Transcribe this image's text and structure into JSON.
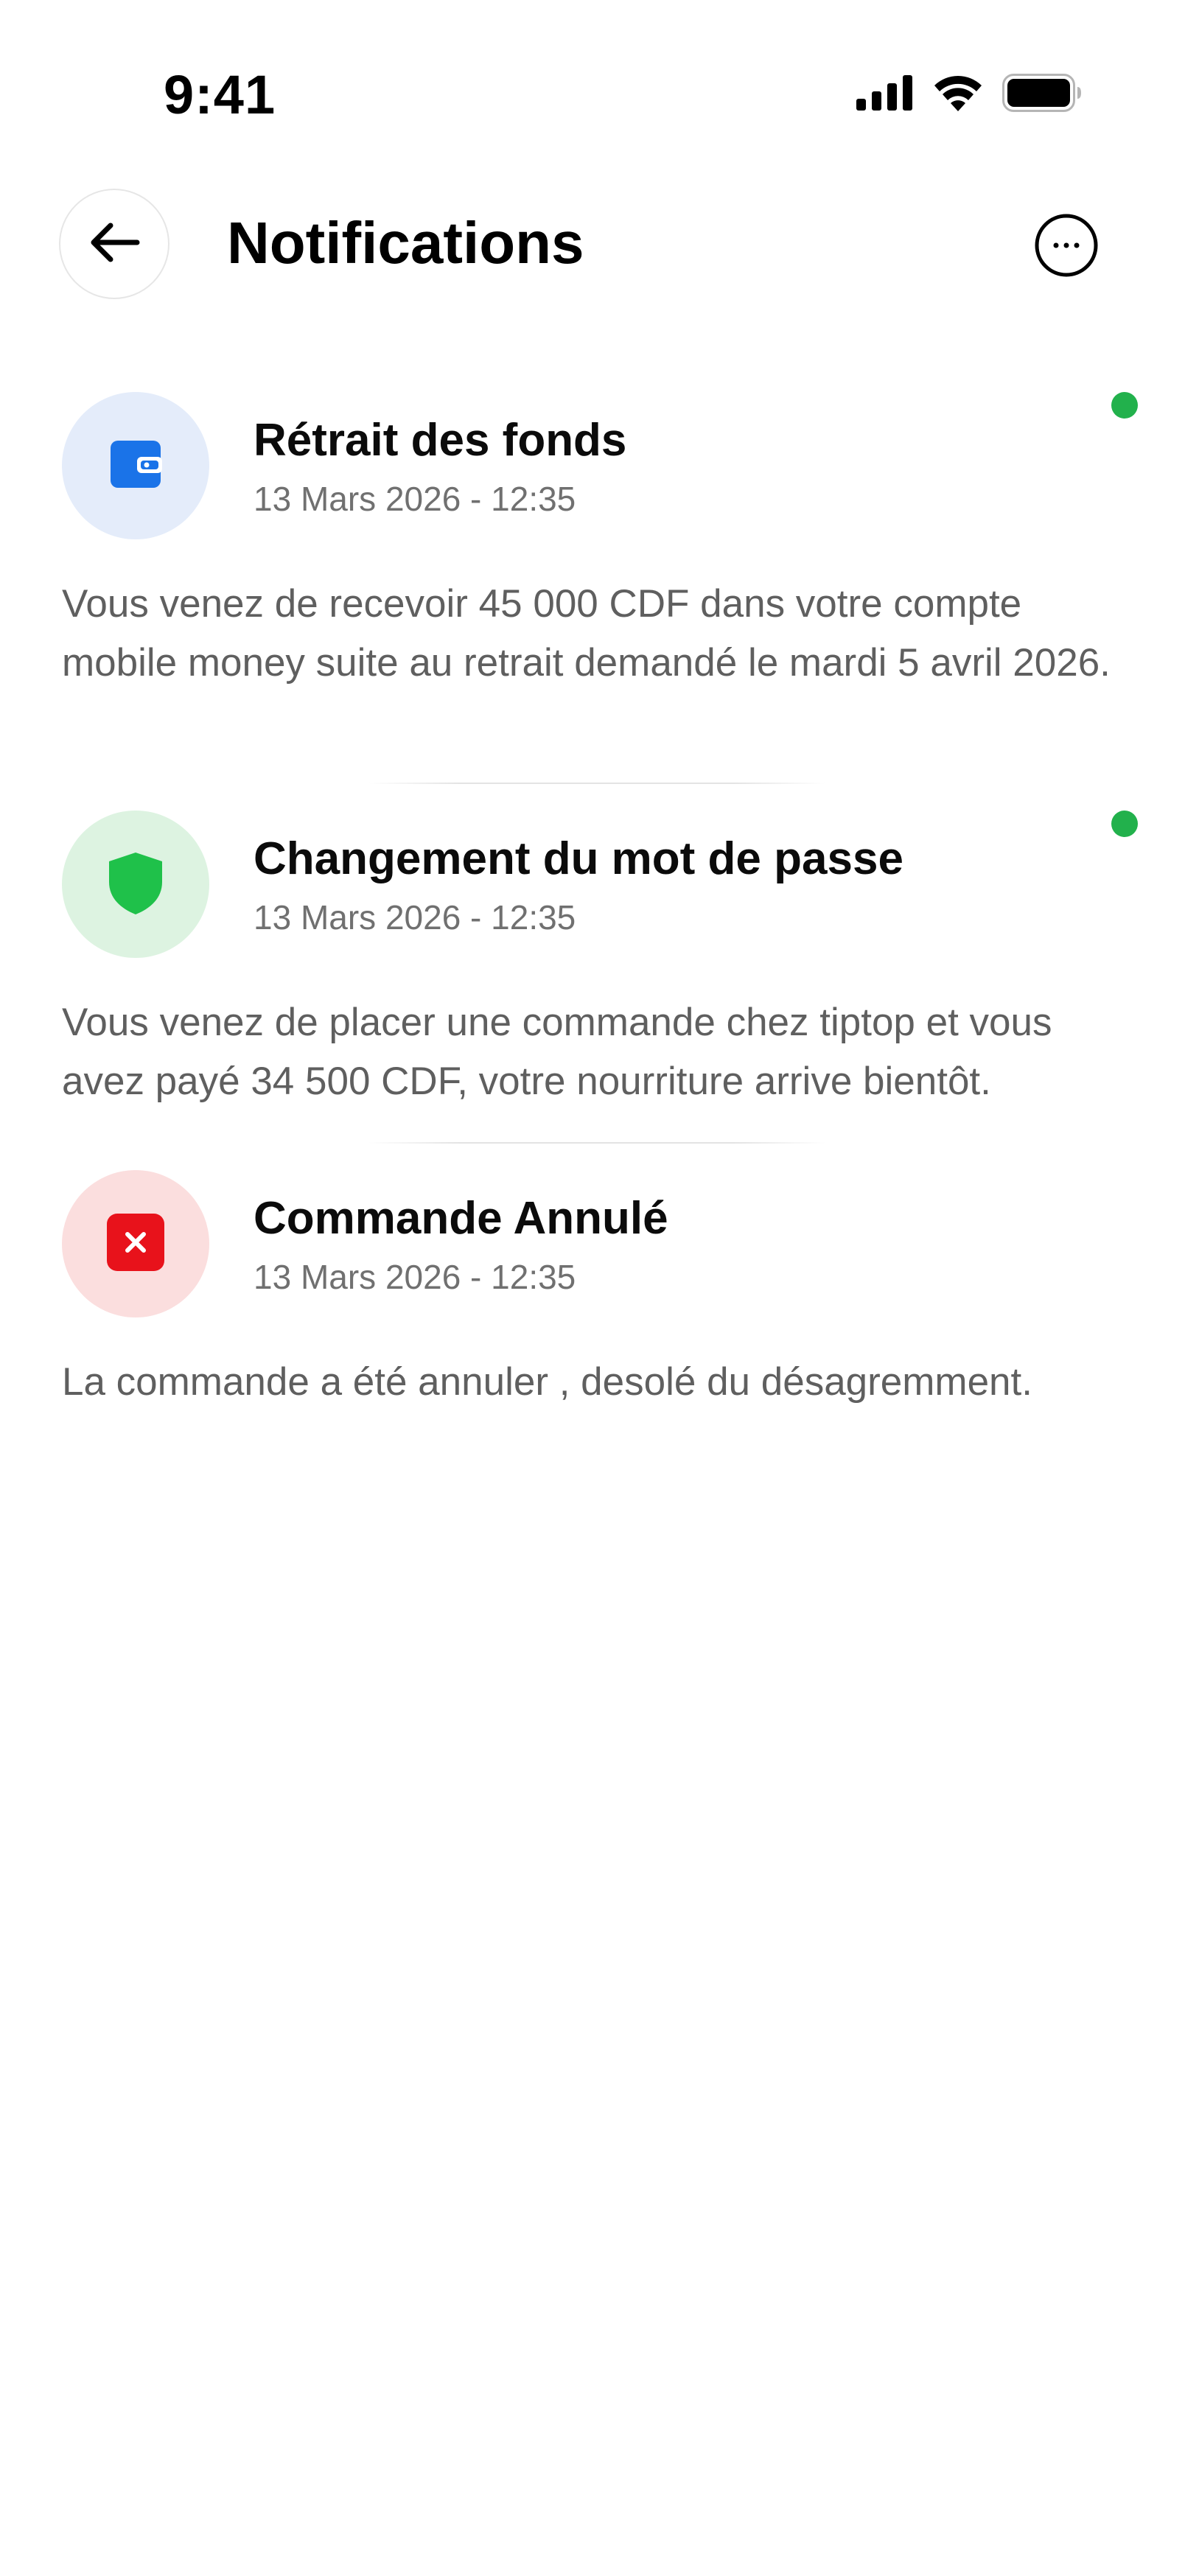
{
  "status_bar": {
    "time": "9:41"
  },
  "header": {
    "title": "Notifications",
    "back_icon": "arrow-left-icon",
    "more_icon": "more-horizontal-icon"
  },
  "notifications": [
    {
      "title": "Rétrait des fonds",
      "date": "13 Mars 2026 - 12:35",
      "body": "Vous venez de recevoir 45 000 CDF dans votre compte mobile money suite au retrait demandé le mardi 5 avril 2026.",
      "icon": "wallet-icon",
      "icon_color": "#1a73e8",
      "avatar_bg": "#e4ecfa",
      "unread": true
    },
    {
      "title": "Changement du mot de passe",
      "date": "13 Mars 2026 - 12:35",
      "body": "Vous venez de placer une commande chez tiptop et vous avez payé 34 500 CDF, votre nourriture arrive bientôt.",
      "icon": "shield-icon",
      "icon_color": "#1fc14a",
      "avatar_bg": "#ddf3e1",
      "unread": true
    },
    {
      "title": "Commande Annulé",
      "date": "13 Mars 2026 - 12:35",
      "body": "La commande a été annuler , desolé du désagremment.",
      "icon": "close-square-icon",
      "icon_color": "#e8121b",
      "avatar_bg": "#fbdede",
      "unread": false
    }
  ],
  "colors": {
    "unread_dot": "#22b14c",
    "body_text": "#5f5f5f",
    "date_text": "#707070"
  }
}
